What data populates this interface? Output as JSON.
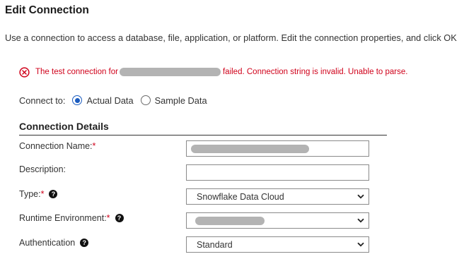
{
  "page": {
    "title": "Edit Connection",
    "intro": "Use a connection to access a database, file, application, or platform. Edit the connection properties, and click OK"
  },
  "error": {
    "prefix": "The test connection for",
    "suffix": "failed. Connection string is invalid. Unable to parse.",
    "color": "#d0021b",
    "icon": "error-circle-x-icon"
  },
  "connect_to": {
    "label": "Connect to:",
    "options": [
      {
        "label": "Actual Data",
        "selected": true
      },
      {
        "label": "Sample Data",
        "selected": false
      }
    ]
  },
  "section": {
    "title": "Connection Details"
  },
  "fields": {
    "connection_name": {
      "label": "Connection Name:",
      "required_mark": "*"
    },
    "description": {
      "label": "Description:",
      "value": ""
    },
    "type": {
      "label": "Type:",
      "required_mark": "*",
      "value": "Snowflake Data Cloud",
      "help_icon": "question-icon"
    },
    "runtime": {
      "label": "Runtime Environment:",
      "required_mark": "*",
      "help_icon": "question-icon"
    },
    "authentication": {
      "label": "Authentication",
      "value": "Standard",
      "help_icon": "question-icon"
    }
  },
  "colors": {
    "accent": "#1a5bbf",
    "required": "#d0021b",
    "redaction": "#b3b3b3"
  }
}
